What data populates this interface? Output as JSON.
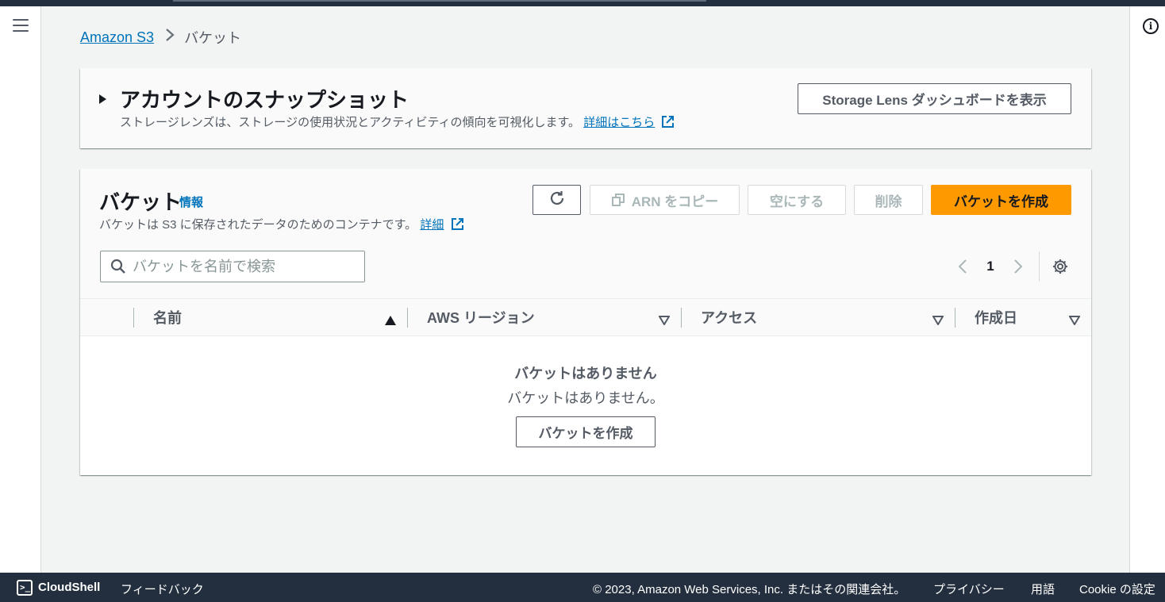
{
  "breadcrumb": {
    "root": "Amazon S3",
    "current": "バケット"
  },
  "snapshot": {
    "title": "アカウントのスナップショット",
    "description": "ストレージレンズは、ストレージの使用状況とアクティビティの傾向を可視化します。",
    "learn_more": "詳細はこちら",
    "lens_button": "Storage Lens ダッシュボードを表示"
  },
  "buckets": {
    "title": "バケット",
    "info": "情報",
    "description": "バケットは S3 に保存されたデータのためのコンテナです。",
    "details_link": "詳細",
    "copy_arn": "ARN をコピー",
    "empty_btn": "空にする",
    "delete_btn": "削除",
    "create_btn": "バケットを作成",
    "search_placeholder": "バケットを名前で検索",
    "page": "1",
    "columns": [
      "名前",
      "AWS リージョン",
      "アクセス",
      "作成日"
    ],
    "empty_title": "バケットはありません",
    "empty_sub": "バケットはありません。",
    "empty_create": "バケットを作成"
  },
  "footer": {
    "cloudshell": "CloudShell",
    "feedback": "フィードバック",
    "copyright": "© 2023, Amazon Web Services, Inc. またはその関連会社。",
    "privacy": "プライバシー",
    "terms": "用語",
    "cookies": "Cookie の設定"
  },
  "colors": {
    "primary": "#ff9900",
    "link": "#0073bb",
    "footer_bg": "#232f3e"
  }
}
